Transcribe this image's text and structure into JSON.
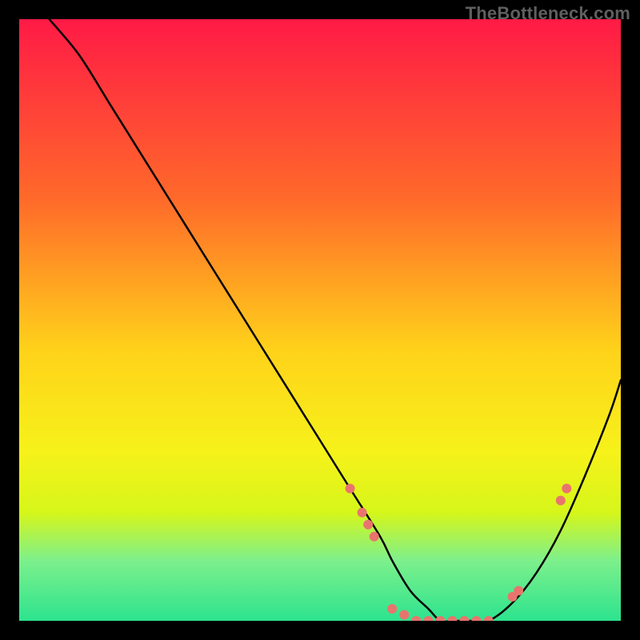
{
  "watermark": "TheBottleneck.com",
  "chart_data": {
    "type": "line",
    "title": "",
    "xlabel": "",
    "ylabel": "",
    "xlim": [
      0,
      100
    ],
    "ylim": [
      0,
      100
    ],
    "grid": false,
    "legend": false,
    "background_gradient_stops": [
      {
        "offset": 0,
        "color": "#ff1a46"
      },
      {
        "offset": 0.3,
        "color": "#ff6a2a"
      },
      {
        "offset": 0.55,
        "color": "#ffd21a"
      },
      {
        "offset": 0.72,
        "color": "#f6f21a"
      },
      {
        "offset": 0.82,
        "color": "#d6f61a"
      },
      {
        "offset": 0.9,
        "color": "#7df08c"
      },
      {
        "offset": 1.0,
        "color": "#2de38e"
      }
    ],
    "series": [
      {
        "name": "bottleneck-curve",
        "color": "#000000",
        "x": [
          5,
          10,
          15,
          20,
          25,
          30,
          35,
          40,
          45,
          50,
          55,
          60,
          62,
          65,
          68,
          70,
          72,
          75,
          78,
          82,
          86,
          90,
          94,
          98,
          100
        ],
        "y": [
          100,
          94,
          86,
          78,
          70,
          62,
          54,
          46,
          38,
          30,
          22,
          14,
          10,
          5,
          2,
          0,
          0,
          0,
          0,
          3,
          8,
          15,
          24,
          34,
          40
        ]
      }
    ],
    "markers": {
      "name": "highlight-dots",
      "color": "#e9746d",
      "radius": 6,
      "points": [
        {
          "x": 55,
          "y": 22
        },
        {
          "x": 57,
          "y": 18
        },
        {
          "x": 58,
          "y": 16
        },
        {
          "x": 59,
          "y": 14
        },
        {
          "x": 62,
          "y": 2
        },
        {
          "x": 64,
          "y": 1
        },
        {
          "x": 66,
          "y": 0
        },
        {
          "x": 68,
          "y": 0
        },
        {
          "x": 70,
          "y": 0
        },
        {
          "x": 72,
          "y": 0
        },
        {
          "x": 74,
          "y": 0
        },
        {
          "x": 76,
          "y": 0
        },
        {
          "x": 78,
          "y": 0
        },
        {
          "x": 82,
          "y": 4
        },
        {
          "x": 83,
          "y": 5
        },
        {
          "x": 90,
          "y": 20
        },
        {
          "x": 91,
          "y": 22
        }
      ]
    }
  }
}
